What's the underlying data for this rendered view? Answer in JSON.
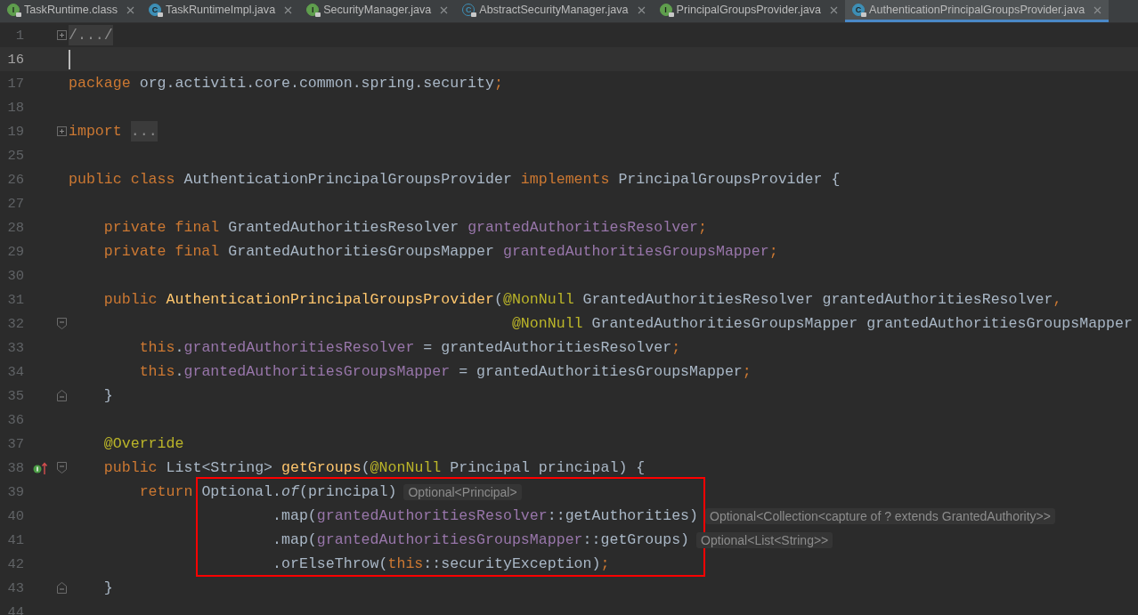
{
  "tabs": [
    {
      "label": "TaskRuntime.class",
      "icon_letter": "I",
      "kind": "interface",
      "selected": false
    },
    {
      "label": "TaskRuntimeImpl.java",
      "icon_letter": "C",
      "kind": "class",
      "selected": false
    },
    {
      "label": "SecurityManager.java",
      "icon_letter": "I",
      "kind": "interface",
      "selected": false
    },
    {
      "label": "AbstractSecurityManager.java",
      "icon_letter": "C",
      "kind": "abstract",
      "selected": false
    },
    {
      "label": "PrincipalGroupsProvider.java",
      "icon_letter": "I",
      "kind": "interface",
      "selected": false
    },
    {
      "label": "AuthenticationPrincipalGroupsProvider.java",
      "icon_letter": "C",
      "kind": "class",
      "selected": true
    }
  ],
  "lines": [
    {
      "number": "1",
      "fold": {
        "kind": "collapsed"
      },
      "tokens": [
        {
          "kind": "folded",
          "text": "/.../"
        }
      ]
    },
    {
      "number": "16",
      "current": true,
      "caret": true
    },
    {
      "number": "17",
      "tokens": [
        {
          "kind": "keyword",
          "text": "package "
        },
        {
          "kind": "plain",
          "text": "org.activiti.core.common.spring.security"
        },
        {
          "kind": "keyword",
          "text": ";"
        }
      ]
    },
    {
      "number": "18"
    },
    {
      "number": "19",
      "fold": {
        "kind": "collapsed"
      },
      "tokens": [
        {
          "kind": "keyword",
          "text": "import "
        },
        {
          "kind": "folded",
          "text": "..."
        }
      ]
    },
    {
      "number": "25"
    },
    {
      "number": "26",
      "tokens": [
        {
          "kind": "keyword",
          "text": "public class "
        },
        {
          "kind": "plain",
          "text": "AuthenticationPrincipalGroupsProvider "
        },
        {
          "kind": "keyword",
          "text": "implements "
        },
        {
          "kind": "plain",
          "text": "PrincipalGroupsProvider {"
        }
      ]
    },
    {
      "number": "27"
    },
    {
      "number": "28",
      "tokens": [
        {
          "kind": "keyword",
          "text": "    private final "
        },
        {
          "kind": "plain",
          "text": "GrantedAuthoritiesResolver "
        },
        {
          "kind": "field",
          "text": "grantedAuthoritiesResolver"
        },
        {
          "kind": "keyword",
          "text": ";"
        }
      ]
    },
    {
      "number": "29",
      "tokens": [
        {
          "kind": "keyword",
          "text": "    private final "
        },
        {
          "kind": "plain",
          "text": "GrantedAuthoritiesGroupsMapper "
        },
        {
          "kind": "field",
          "text": "grantedAuthoritiesGroupsMapper"
        },
        {
          "kind": "keyword",
          "text": ";"
        }
      ]
    },
    {
      "number": "30"
    },
    {
      "number": "31",
      "tokens": [
        {
          "kind": "keyword",
          "text": "    public "
        },
        {
          "kind": "method",
          "text": "AuthenticationPrincipalGroupsProvider"
        },
        {
          "kind": "plain",
          "text": "("
        },
        {
          "kind": "annotation",
          "text": "@NonNull "
        },
        {
          "kind": "plain",
          "text": "GrantedAuthoritiesResolver grantedAuthoritiesResolver"
        },
        {
          "kind": "keyword",
          "text": ","
        }
      ]
    },
    {
      "number": "32",
      "fold": {
        "kind": "start"
      },
      "tokens": [
        {
          "kind": "annotation",
          "text": "                                                  @NonNull "
        },
        {
          "kind": "plain",
          "text": "GrantedAuthoritiesGroupsMapper grantedAuthoritiesGroupsMapper"
        }
      ]
    },
    {
      "number": "33",
      "tokens": [
        {
          "kind": "keyword",
          "text": "        this"
        },
        {
          "kind": "plain",
          "text": "."
        },
        {
          "kind": "field",
          "text": "grantedAuthoritiesResolver"
        },
        {
          "kind": "plain",
          "text": " = grantedAuthoritiesResolver"
        },
        {
          "kind": "keyword",
          "text": ";"
        }
      ]
    },
    {
      "number": "34",
      "tokens": [
        {
          "kind": "keyword",
          "text": "        this"
        },
        {
          "kind": "plain",
          "text": "."
        },
        {
          "kind": "field",
          "text": "grantedAuthoritiesGroupsMapper"
        },
        {
          "kind": "plain",
          "text": " = grantedAuthoritiesGroupsMapper"
        },
        {
          "kind": "keyword",
          "text": ";"
        }
      ]
    },
    {
      "number": "35",
      "fold": {
        "kind": "end"
      },
      "tokens": [
        {
          "kind": "plain",
          "text": "    }"
        }
      ]
    },
    {
      "number": "36"
    },
    {
      "number": "37",
      "tokens": [
        {
          "kind": "annotation",
          "text": "    @Override"
        }
      ]
    },
    {
      "number": "38",
      "fold": {
        "kind": "start"
      },
      "override_marker": true,
      "tokens": [
        {
          "kind": "keyword",
          "text": "    public "
        },
        {
          "kind": "plain",
          "text": "List<String> "
        },
        {
          "kind": "method",
          "text": "getGroups"
        },
        {
          "kind": "plain",
          "text": "("
        },
        {
          "kind": "annotation",
          "text": "@NonNull "
        },
        {
          "kind": "plain",
          "text": "Principal principal) {"
        }
      ]
    },
    {
      "number": "39",
      "boxed": true,
      "hint": "Optional<Principal>",
      "tokens": [
        {
          "kind": "keyword",
          "text": "        return "
        },
        {
          "kind": "plain",
          "text": "Optional."
        },
        {
          "kind": "static",
          "text": "of"
        },
        {
          "kind": "plain",
          "text": "(principal)"
        }
      ]
    },
    {
      "number": "40",
      "boxed": true,
      "hint": "Optional<Collection<capture of ? extends GrantedAuthority>>",
      "tokens": [
        {
          "kind": "plain",
          "text": "                       .map("
        },
        {
          "kind": "field",
          "text": "grantedAuthoritiesResolver"
        },
        {
          "kind": "plain",
          "text": "::getAuthorities)"
        }
      ]
    },
    {
      "number": "41",
      "boxed": true,
      "hint": "Optional<List<String>>",
      "tokens": [
        {
          "kind": "plain",
          "text": "                       .map("
        },
        {
          "kind": "field",
          "text": "grantedAuthoritiesGroupsMapper"
        },
        {
          "kind": "plain",
          "text": "::getGroups)"
        }
      ]
    },
    {
      "number": "42",
      "boxed": true,
      "tokens": [
        {
          "kind": "plain",
          "text": "                       .orElseThrow("
        },
        {
          "kind": "keyword",
          "text": "this"
        },
        {
          "kind": "plain",
          "text": "::securityException)"
        },
        {
          "kind": "keyword",
          "text": ";"
        }
      ]
    },
    {
      "number": "43",
      "fold": {
        "kind": "end"
      },
      "tokens": [
        {
          "kind": "plain",
          "text": "    }"
        }
      ]
    },
    {
      "number": "44"
    }
  ]
}
